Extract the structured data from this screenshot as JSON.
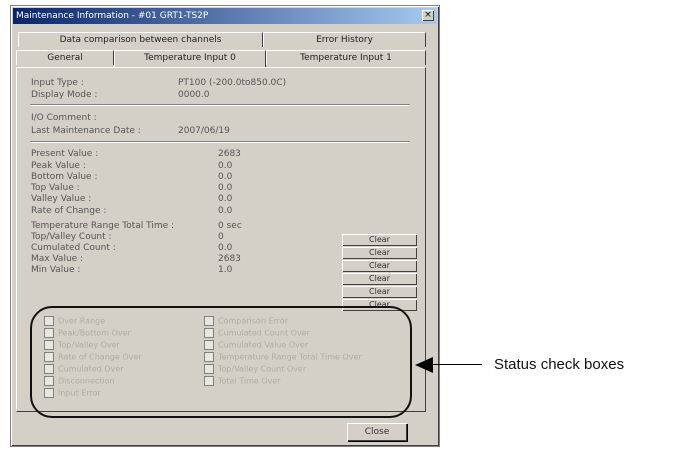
{
  "window": {
    "title": "Maintenance Information - #01 GRT1-TS2P",
    "close_glyph": "×"
  },
  "tabs_back": [
    "Data comparison between channels",
    "Error History"
  ],
  "tabs_front": [
    {
      "label": "General",
      "active": false
    },
    {
      "label": "Temperature Input 0",
      "active": true
    },
    {
      "label": "Temperature Input 1",
      "active": false
    }
  ],
  "info": {
    "input_type_label": "Input Type :",
    "input_type_value": "PT100 (-200.0to850.0C)",
    "display_mode_label": "Display Mode :",
    "display_mode_value": "0000.0",
    "io_comment_label": "I/O Comment :",
    "last_maint_label": "Last Maintenance Date :",
    "last_maint_value": "2007/06/19"
  },
  "values": [
    {
      "label": "Present Value :",
      "value": "2683"
    },
    {
      "label": "Peak Value :",
      "value": "0.0"
    },
    {
      "label": "Bottom Value :",
      "value": "0.0"
    },
    {
      "label": "Top Value :",
      "value": "0.0"
    },
    {
      "label": "Valley Value :",
      "value": "0.0"
    },
    {
      "label": "Rate of Change :",
      "value": "0.0"
    },
    {
      "label": "Temperature Range Total Time :",
      "value": "0 sec"
    },
    {
      "label": "Top/Valley Count :",
      "value": "0"
    },
    {
      "label": "Cumulated Count :",
      "value": "0.0"
    },
    {
      "label": "Max Value :",
      "value": "2683"
    },
    {
      "label": "Min Value :",
      "value": "1.0"
    }
  ],
  "clear_label": "Clear",
  "checkboxes_left": [
    "Over Range",
    "Peak/Bottom Over",
    "Top/Valley Over",
    "Rate of Change Over",
    "Cumulated Over",
    "Disconnection",
    "Input Error"
  ],
  "checkboxes_right": [
    "Comparison Error",
    "Cumulated Count Over",
    "Cumulated Value Over",
    "Temperature Range Total Time Over",
    "Top/Valley Count Over",
    "Total Time Over"
  ],
  "close_label": "Close",
  "callout": {
    "text": "Status check boxes"
  }
}
